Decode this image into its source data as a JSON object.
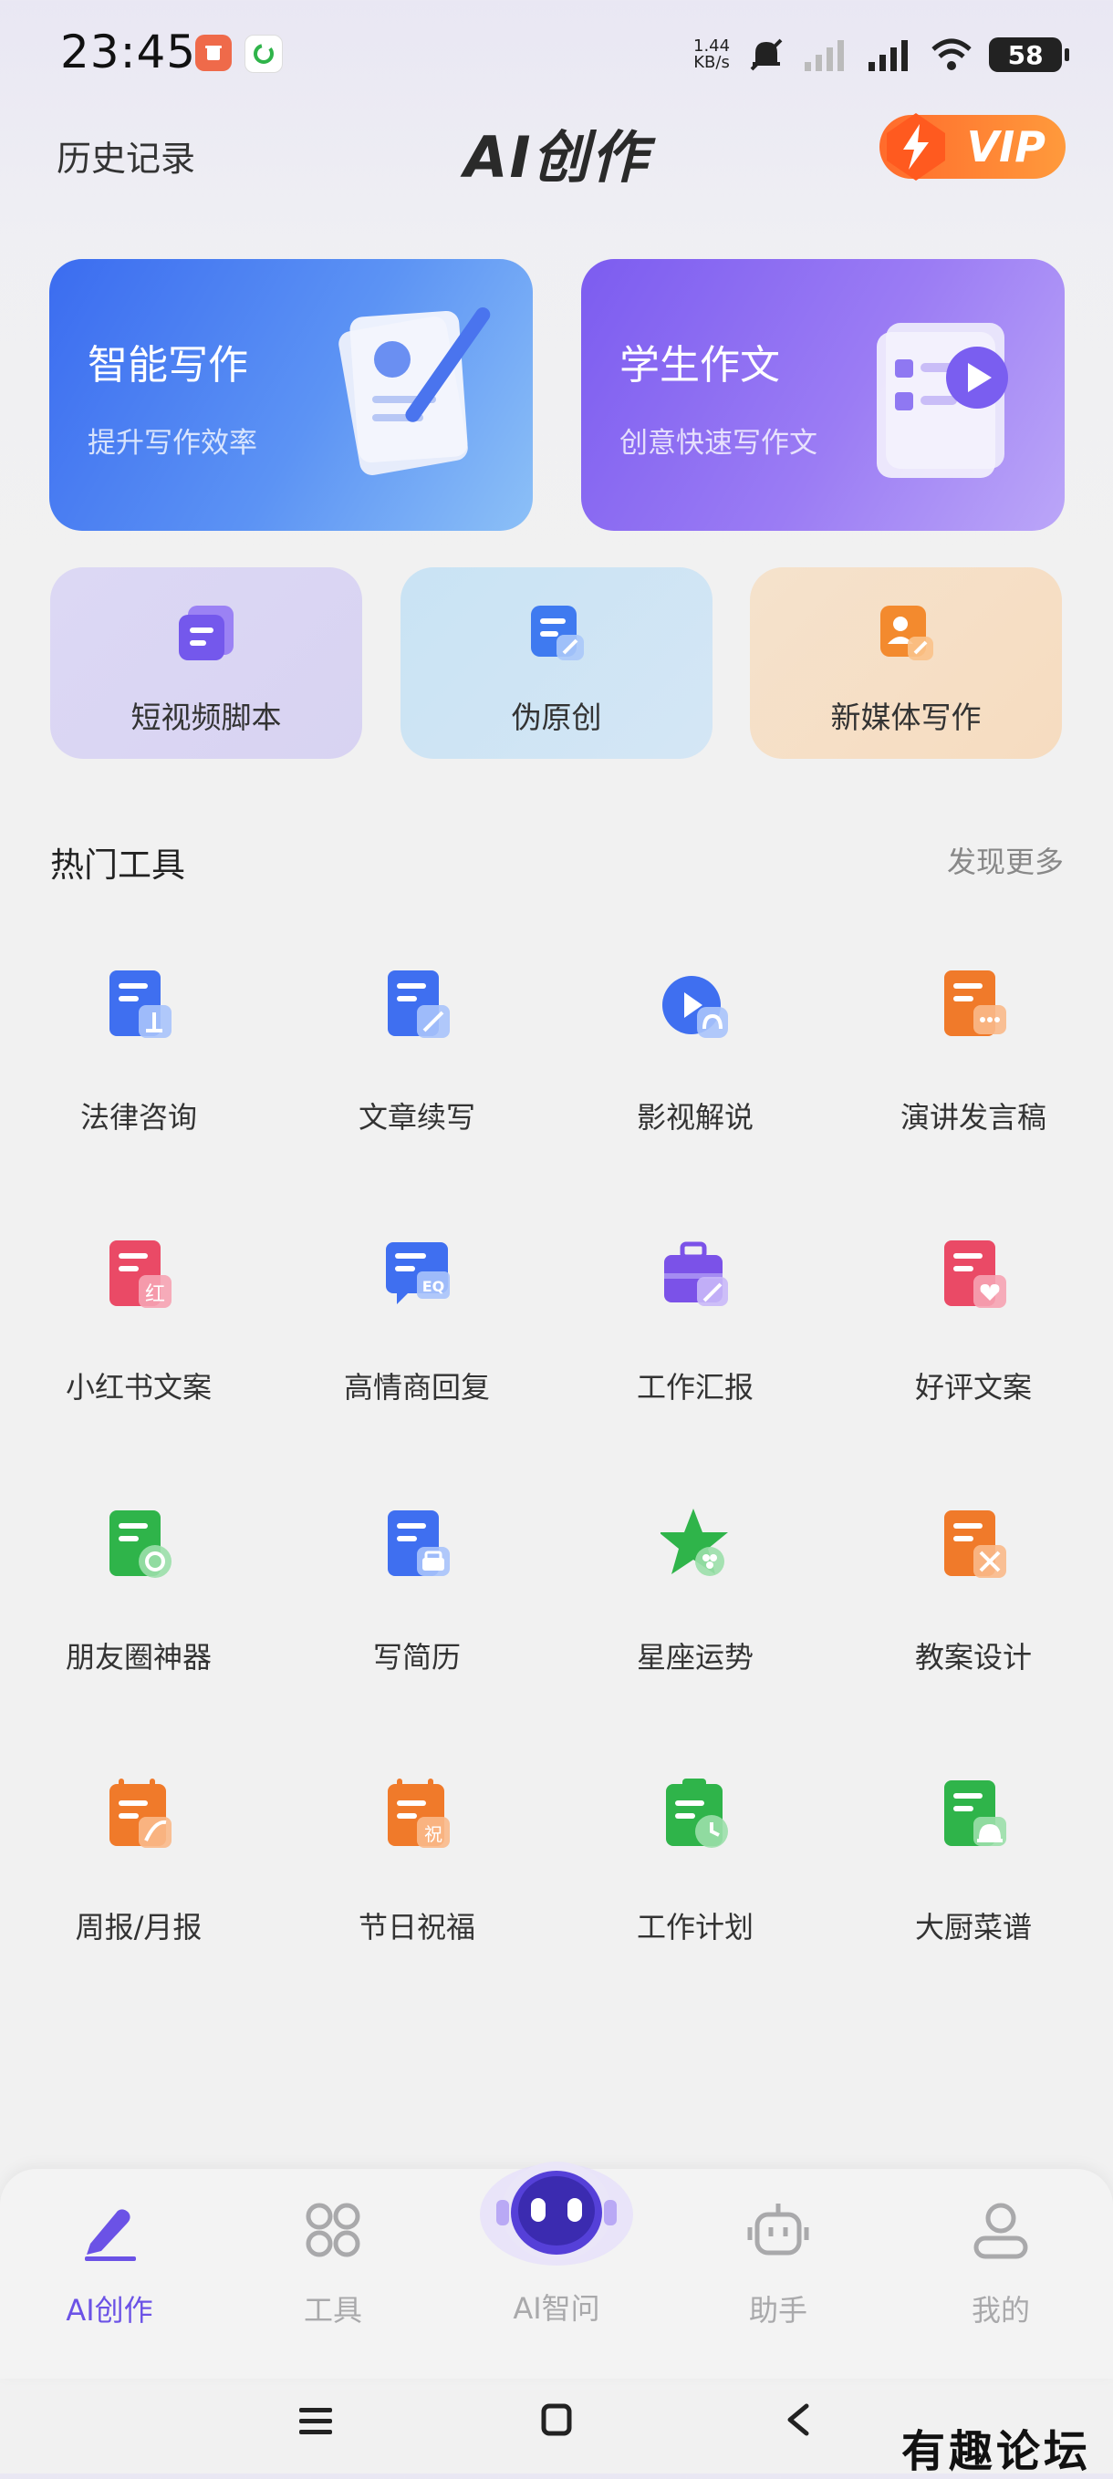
{
  "status_bar": {
    "time": "23:45",
    "net_speed_value": "1.44",
    "net_speed_unit": "KB/s",
    "battery": "58"
  },
  "header": {
    "history_label": "历史记录",
    "title": "AI创作",
    "vip_label": "VIP"
  },
  "feature_cards": [
    {
      "title": "智能写作",
      "subtitle": "提升写作效率"
    },
    {
      "title": "学生作文",
      "subtitle": "创意快速写作文"
    }
  ],
  "quick_cards": [
    {
      "label": "短视频脚本",
      "icon": "video-script-icon"
    },
    {
      "label": "伪原创",
      "icon": "rewrite-icon"
    },
    {
      "label": "新媒体写作",
      "icon": "new-media-icon"
    }
  ],
  "hot_tools": {
    "title": "热门工具",
    "more_label": "发现更多",
    "items": [
      {
        "label": "法律咨询",
        "icon": "law-icon",
        "color": "#3f6ff0"
      },
      {
        "label": "文章续写",
        "icon": "article-continue-icon",
        "color": "#3f6ff0"
      },
      {
        "label": "影视解说",
        "icon": "film-commentary-icon",
        "color": "#3f6ff0"
      },
      {
        "label": "演讲发言稿",
        "icon": "speech-icon",
        "color": "#f07a2a"
      },
      {
        "label": "小红书文案",
        "icon": "xiaohongshu-icon",
        "color": "#ea4a66"
      },
      {
        "label": "高情商回复",
        "icon": "eq-reply-icon",
        "color": "#3f6ff0"
      },
      {
        "label": "工作汇报",
        "icon": "work-report-icon",
        "color": "#7b52e8"
      },
      {
        "label": "好评文案",
        "icon": "good-review-icon",
        "color": "#ea4a66"
      },
      {
        "label": "朋友圈神器",
        "icon": "moments-icon",
        "color": "#2fb44a"
      },
      {
        "label": "写简历",
        "icon": "resume-icon",
        "color": "#3f6ff0"
      },
      {
        "label": "星座运势",
        "icon": "horoscope-icon",
        "color": "#2fb44a"
      },
      {
        "label": "教案设计",
        "icon": "lesson-plan-icon",
        "color": "#f07a2a"
      },
      {
        "label": "周报/月报",
        "icon": "weekly-report-icon",
        "color": "#f07a2a"
      },
      {
        "label": "节日祝福",
        "icon": "holiday-greeting-icon",
        "color": "#f07a2a"
      },
      {
        "label": "工作计划",
        "icon": "work-plan-icon",
        "color": "#2fb44a"
      },
      {
        "label": "大厨菜谱",
        "icon": "recipe-icon",
        "color": "#2fb44a"
      }
    ]
  },
  "bottom_nav": {
    "items": [
      {
        "label": "AI创作",
        "icon": "pen-icon",
        "active": true
      },
      {
        "label": "工具",
        "icon": "grid-icon",
        "active": false
      },
      {
        "label": "AI智问",
        "icon": "robot-icon",
        "active": false
      },
      {
        "label": "助手",
        "icon": "assistant-icon",
        "active": false
      },
      {
        "label": "我的",
        "icon": "user-icon",
        "active": false
      }
    ]
  },
  "watermark": "有趣论坛",
  "colors": {
    "accent": "#6b52e6",
    "blue_card": "#3b6cf0",
    "purple_card": "#7c5cf0",
    "vip": "#ff7a30"
  }
}
